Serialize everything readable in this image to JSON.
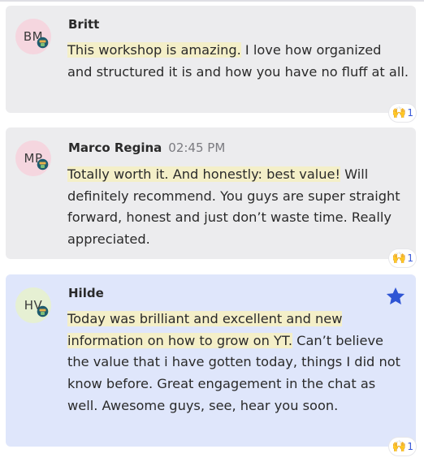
{
  "messages": [
    {
      "initials": "BM",
      "avatar_color": "#f5d6df",
      "name": "Britt",
      "time": "",
      "highlight": "This workshop is amazing.",
      "text": " I love how organized and structured it is and how you have no fluff at all.",
      "reaction_emoji": "🙌",
      "reaction_count": "1",
      "starred": false
    },
    {
      "initials": "MP",
      "avatar_color": "#f5d6df",
      "name": "Marco Regina",
      "time": "02:45 PM",
      "highlight": "Totally worth it. And honestly: best value!",
      "text": " Will definitely recommend. You guys are super straight forward, honest and just don’t waste time. Really appreciated.",
      "reaction_emoji": "🙌",
      "reaction_count": "1",
      "starred": false
    },
    {
      "initials": "HV",
      "avatar_color": "#e6f0d3",
      "name": "Hilde",
      "time": "",
      "highlight": "Today was brilliant and excellent and new information on how to grow on YT.",
      "text": " Can’t believe the value that i have gotten today, things I did not know before. Great engagement in the chat as well. Awesome guys, see, hear you soon.",
      "reaction_emoji": "🙌",
      "reaction_count": "1",
      "starred": true
    }
  ],
  "colors": {
    "card_grey": "#ececee",
    "card_starred": "#dfe6fb",
    "highlight": "#f4efc8",
    "star": "#2f55d4",
    "reaction_count": "#3a5ad8"
  },
  "icons": {
    "badge": "host-badge-icon",
    "star": "star-icon",
    "reaction": "raised-hands-emoji"
  }
}
